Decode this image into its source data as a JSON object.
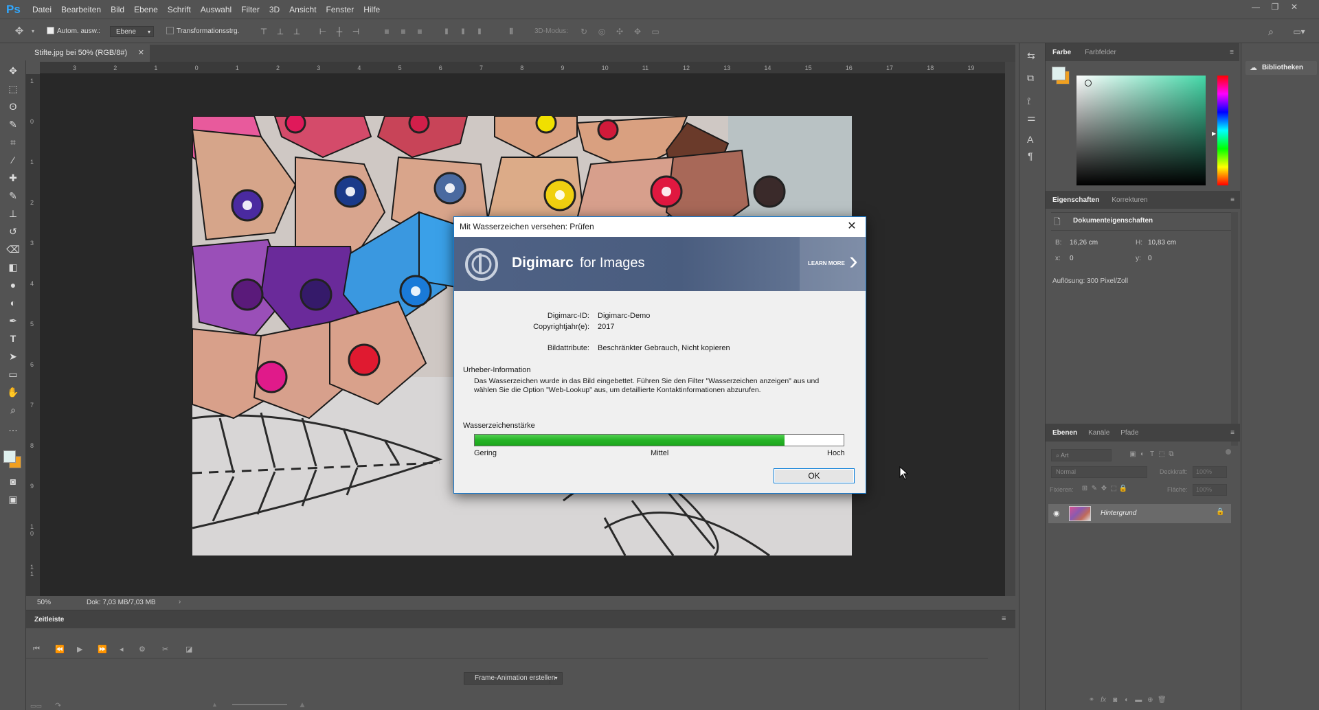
{
  "app": {
    "logo": "Ps",
    "menu": [
      "Datei",
      "Bearbeiten",
      "Bild",
      "Ebene",
      "Schrift",
      "Auswahl",
      "Filter",
      "3D",
      "Ansicht",
      "Fenster",
      "Hilfe"
    ]
  },
  "window_controls": {
    "minimize": "—",
    "restore": "❐",
    "close": "✕"
  },
  "options": {
    "auto_select": "Autom. ausw.:",
    "target": "Ebene",
    "transform": "Transformationsstrg.",
    "mode_3d": "3D-Modus:"
  },
  "document": {
    "tab_label": "Stifte.jpg bei 50% (RGB/8#)",
    "zoom": "50%",
    "doc_size": "Dok: 7,03 MB/7,03 MB"
  },
  "ruler": {
    "h_ticks": [
      "3",
      "2",
      "1",
      "0",
      "1",
      "2",
      "3",
      "4",
      "5",
      "6",
      "7",
      "8",
      "9",
      "10",
      "11",
      "12",
      "13",
      "14",
      "15",
      "16",
      "17",
      "18",
      "19"
    ],
    "v_ticks": [
      "1",
      "0",
      "1",
      "2",
      "3",
      "4",
      "5",
      "6",
      "7",
      "8",
      "9",
      "1 0",
      "1 1"
    ]
  },
  "timeline": {
    "title": "Zeitleiste",
    "create_button": "Frame-Animation erstellen"
  },
  "panels": {
    "color_tabs": [
      "Farbe",
      "Farbfelder"
    ],
    "properties_tabs": [
      "Eigenschaften",
      "Korrekturen"
    ],
    "properties_title": "Dokumenteigenschaften",
    "props": {
      "w_label": "B:",
      "w_value": "16,26 cm",
      "h_label": "H:",
      "h_value": "10,83 cm",
      "x_label": "x:",
      "x_value": "0",
      "y_label": "y:",
      "y_value": "0",
      "resolution": "Auflösung: 300 Pixel/Zoll"
    },
    "layers_tabs": [
      "Ebenen",
      "Kanäle",
      "Pfade"
    ],
    "layer_filter": "Art",
    "blend_mode": "Normal",
    "opacity_label": "Deckkraft:",
    "opacity_value": "100%",
    "lock_label": "Fixieren:",
    "fill_label": "Fläche:",
    "fill_value": "100%",
    "layer_name": "Hintergrund",
    "libraries": "Bibliotheken"
  },
  "dialog": {
    "title": "Mit Wasserzeichen versehen: Prüfen",
    "banner_brand": "Digimarc",
    "banner_suffix": "for Images",
    "learn_more": "LEARN MORE",
    "id_label": "Digimarc-ID:",
    "id_value": "Digimarc-Demo",
    "year_label": "Copyrightjahr(e):",
    "year_value": "2017",
    "attr_label": "Bildattribute:",
    "attr_value": "Beschränkter Gebrauch, Nicht kopieren",
    "creator_heading": "Urheber-Information",
    "creator_text_1": "Das Wasserzeichen wurde in das Bild eingebettet. Führen Sie den Filter \"Wasserzeichen anzeigen\" aus und",
    "creator_text_2": "wählen Sie die Option \"Web-Lookup\" aus, um detaillierte Kontaktinformationen abzurufen.",
    "strength_label": "Wasserzeichenstärke",
    "strength_fraction": 0.84,
    "scale_low": "Gering",
    "scale_mid": "Mittel",
    "scale_high": "Hoch",
    "ok": "OK"
  },
  "colors": {
    "accent": "#31a8ff",
    "meter": "#26b326",
    "dialog_border": "#1979ca",
    "fg_swatch": "#dff0ee",
    "bg_swatch": "#f0a020"
  }
}
